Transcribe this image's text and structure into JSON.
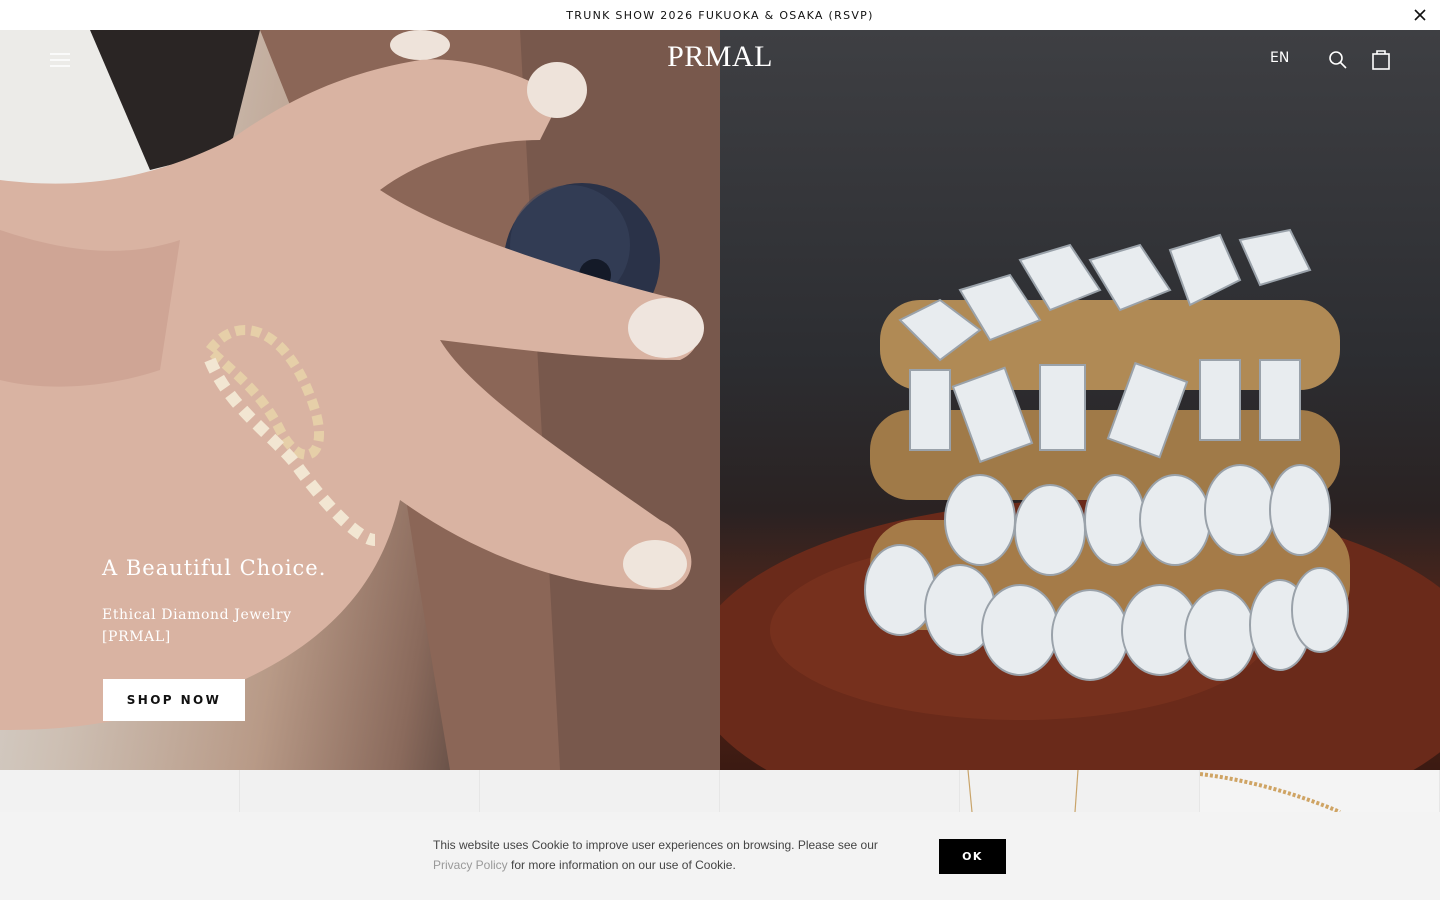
{
  "announcement": {
    "text": "TRUNK SHOW 2026 FUKUOKA & OSAKA (RSVP)",
    "close_icon": "close-icon"
  },
  "header": {
    "logo": "PRMAL",
    "language": "EN",
    "menu_icon": "hamburger-menu-icon",
    "search_icon": "search-icon",
    "cart_icon": "shopping-bag-icon"
  },
  "hero": {
    "title": "A Beautiful Choice.",
    "subtitle_line1": "Ethical Diamond Jewelry",
    "subtitle_line2": "[PRMAL]",
    "cta_label": "SHOP NOW"
  },
  "cookie": {
    "text_before": "This website uses Cookie to improve user experiences on browsing. Please see our",
    "link_text": "Privacy Policy",
    "text_after": " for more information on our use of Cookie.",
    "ok_label": "OK"
  },
  "colors": {
    "announcement_bg": "#ffffff",
    "button_dark": "#000000",
    "cookie_bg": "#f3f3f3",
    "link": "#999999"
  }
}
